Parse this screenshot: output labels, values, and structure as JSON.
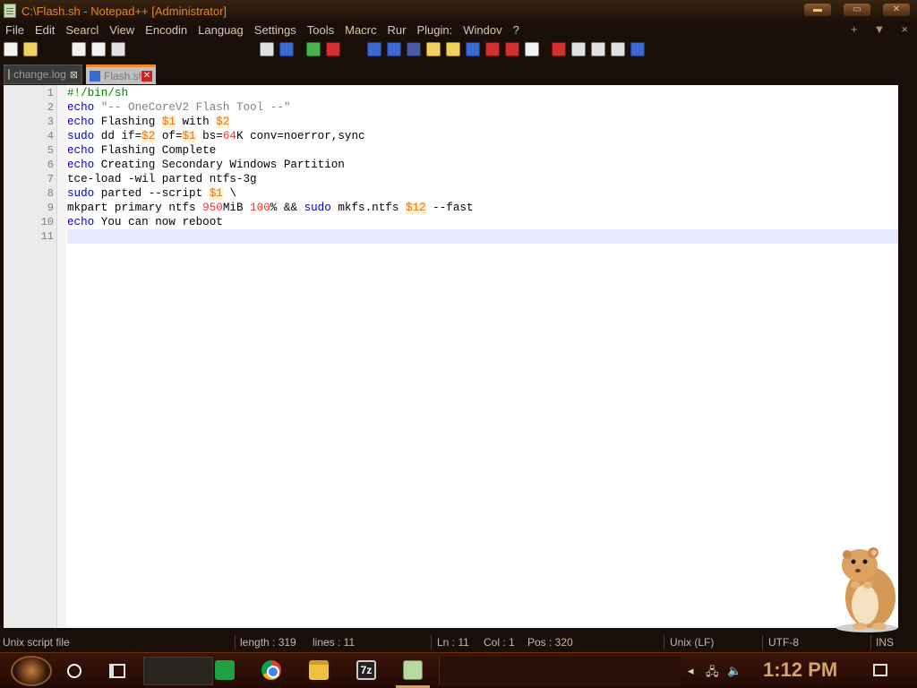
{
  "window": {
    "title": "C:\\Flash.sh - Notepad++ [Administrator]"
  },
  "menu": [
    "File",
    "Edit",
    "Searcl",
    "View",
    "Encodin",
    "Languag",
    "Settings",
    "Tools",
    "Macrc",
    "Rur",
    "Plugin:",
    "Windov",
    "?"
  ],
  "menu_right": [
    "+",
    "▼",
    "×"
  ],
  "tabs": [
    {
      "label": "change.log",
      "close": "⊠"
    },
    {
      "label": "Flash.sh",
      "close": "✕"
    }
  ],
  "code_lines": [
    {
      "n": "1",
      "html": "<span class='com'>#!/bin/sh</span>"
    },
    {
      "n": "2",
      "html": "<span class='kw'>echo</span> <span class='str'>\"-- OneCoreV2 Flash Tool --\"</span>"
    },
    {
      "n": "3",
      "html": "<span class='kw'>echo</span> Flashing <span class='var'>$1</span> with <span class='var'>$2</span>"
    },
    {
      "n": "4",
      "html": "<span class='kw'>sudo</span> dd if=<span class='var'>$2</span> of=<span class='var'>$1</span> bs=<span class='num'>64</span>K conv=noerror,sync"
    },
    {
      "n": "5",
      "html": "<span class='kw'>echo</span> Flashing Complete"
    },
    {
      "n": "6",
      "html": "<span class='kw'>echo</span> Creating Secondary Windows Partition"
    },
    {
      "n": "7",
      "html": "tce-load -wil parted ntfs-3g"
    },
    {
      "n": "8",
      "html": "<span class='kw'>sudo</span> parted --script <span class='var'>$1</span> \\"
    },
    {
      "n": "9",
      "html": "mkpart primary ntfs <span class='num'>950</span>MiB <span class='num'>100</span>% &amp;&amp; <span class='kw'>sudo</span> mkfs.ntfs <span class='var'>$12</span> --fast"
    },
    {
      "n": "10",
      "html": "<span class='kw'>echo</span> You can now reboot"
    },
    {
      "n": "11",
      "html": ""
    }
  ],
  "status": {
    "file_type": "Unix script file",
    "length": "length : 319",
    "lines": "lines : 11",
    "ln": "Ln : 11",
    "col": "Col : 1",
    "pos": "Pos : 320",
    "eol": "Unix (LF)",
    "encoding": "UTF-8",
    "mode": "INS"
  },
  "taskbar": {
    "clock": "1:12 PM",
    "apps": [
      "google-sheets",
      "chrome",
      "file-explorer",
      "7-zip",
      "notepad-plus-plus"
    ],
    "sevenzip_label": "7z"
  }
}
